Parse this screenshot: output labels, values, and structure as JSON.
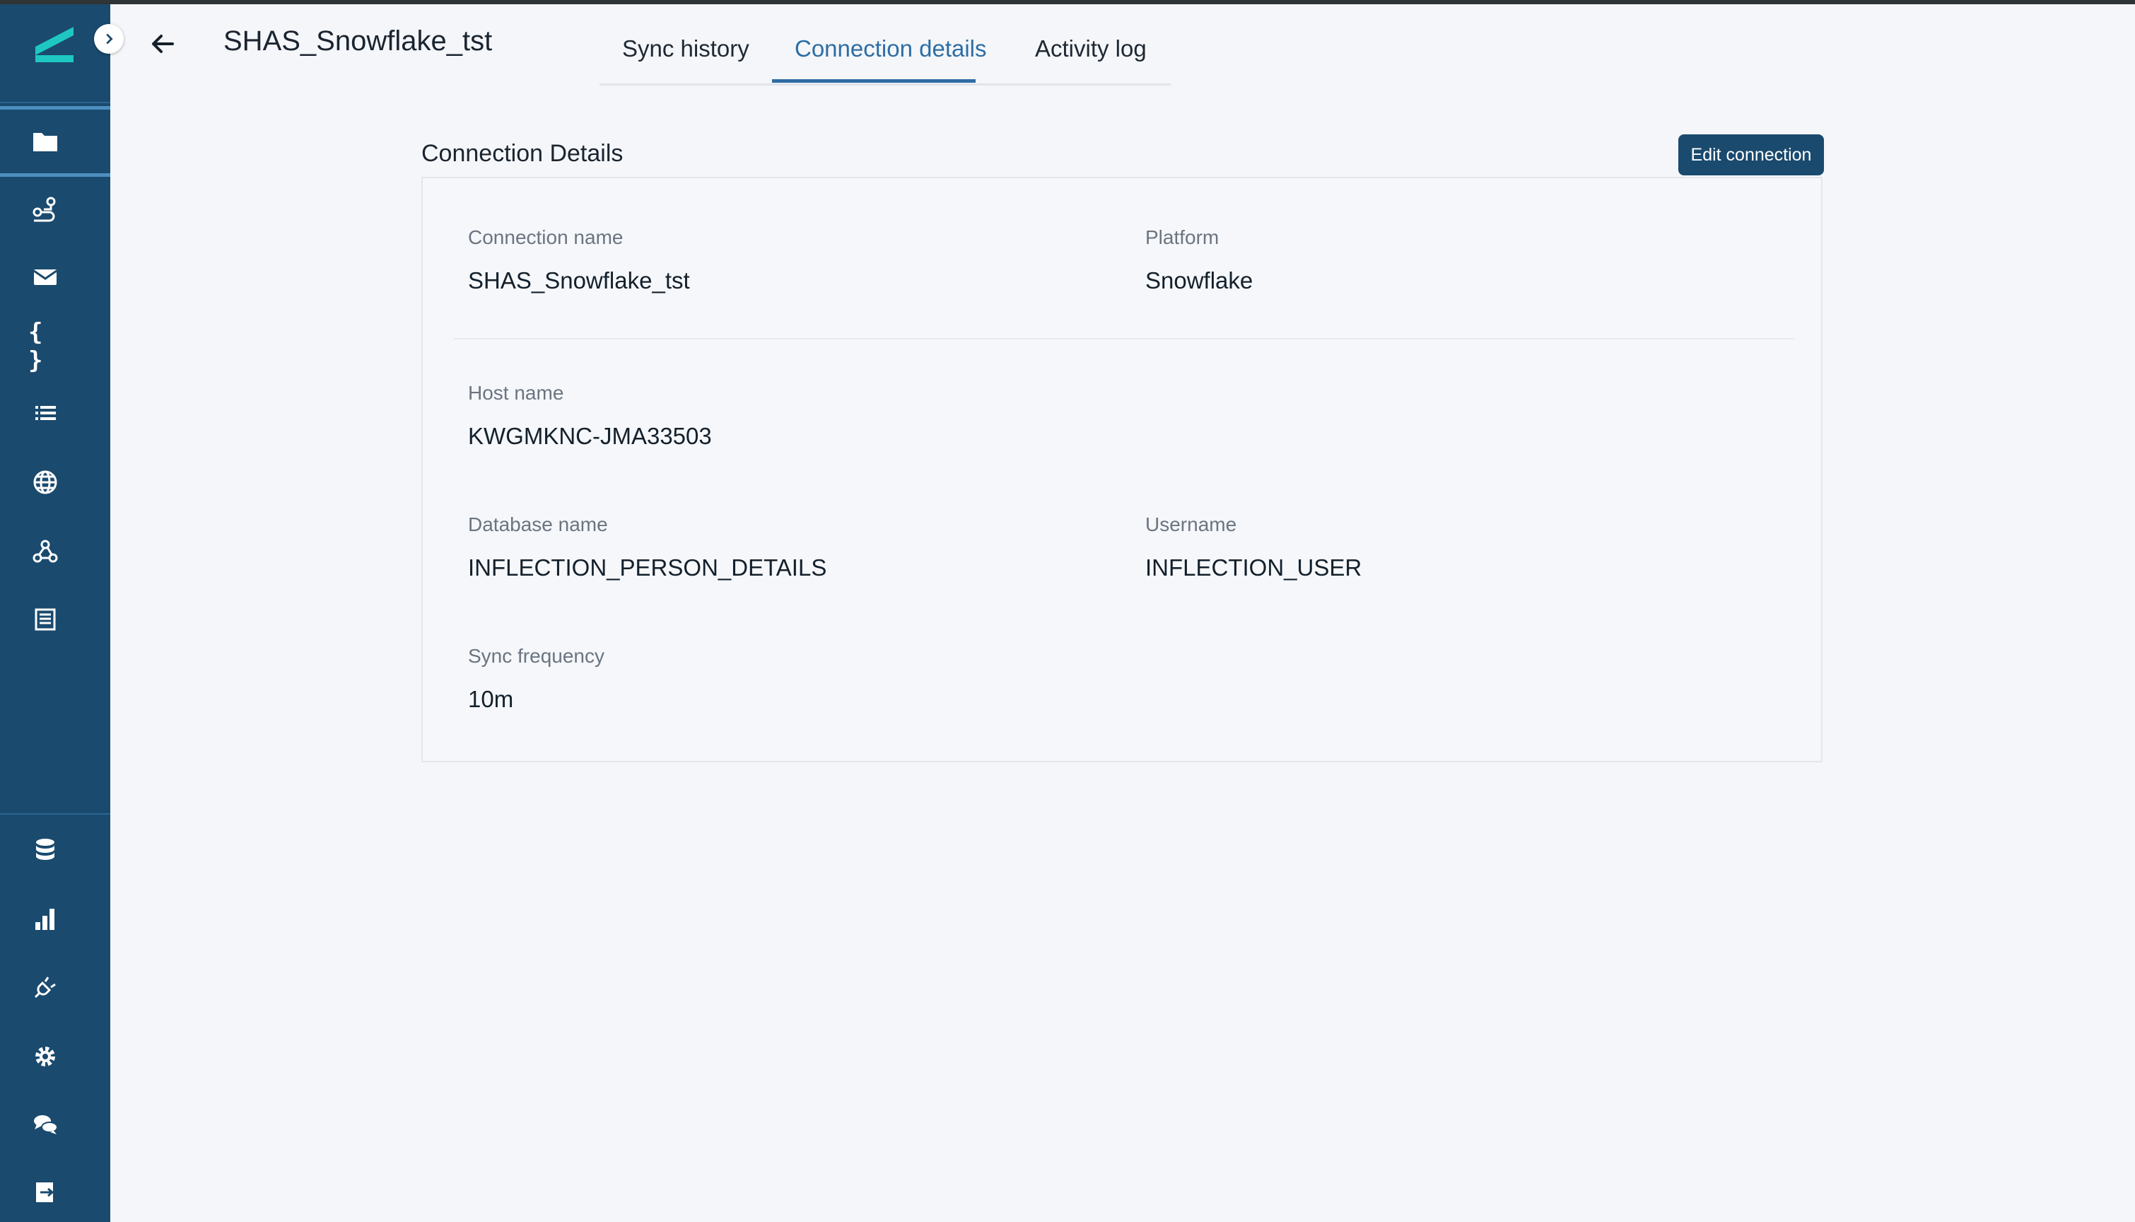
{
  "header": {
    "title": "SHAS_Snowflake_tst"
  },
  "tabs": [
    {
      "label": "Sync history",
      "active": false
    },
    {
      "label": "Connection details",
      "active": true
    },
    {
      "label": "Activity log",
      "active": false
    }
  ],
  "section": {
    "title": "Connection Details",
    "edit_button_label": "Edit connection"
  },
  "fields": {
    "connection_name": {
      "label": "Connection name",
      "value": "SHAS_Snowflake_tst"
    },
    "platform": {
      "label": "Platform",
      "value": "Snowflake"
    },
    "host_name": {
      "label": "Host name",
      "value": "KWGMKNC-JMA33503"
    },
    "database_name": {
      "label": "Database name",
      "value": "INFLECTION_PERSON_DETAILS"
    },
    "username": {
      "label": "Username",
      "value": "INFLECTION_USER"
    },
    "sync_frequency": {
      "label": "Sync frequency",
      "value": "10m"
    }
  },
  "sidebar": {
    "top_icons": [
      "folder-icon",
      "route-icon",
      "mail-icon",
      "code-braces-icon",
      "list-icon",
      "globe-icon",
      "webhook-icon",
      "table-icon"
    ],
    "bottom_icons": [
      "database-icon",
      "bar-chart-icon",
      "plug-icon",
      "gear-icon",
      "chat-icon",
      "logout-icon"
    ]
  },
  "colors": {
    "sidebar": "#1a4a6e",
    "accent": "#2e6da4",
    "logo": "#1fc7c2",
    "background": "#f4f6f9"
  }
}
